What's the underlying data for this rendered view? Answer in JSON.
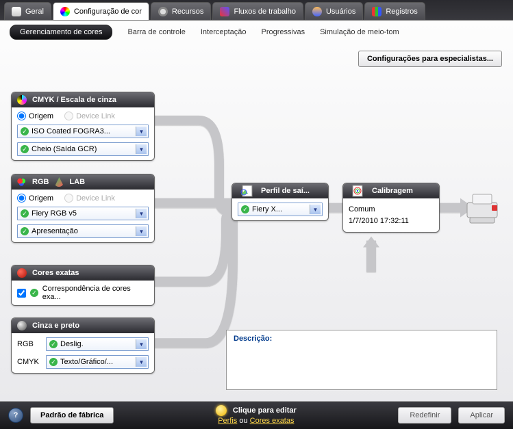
{
  "tabs": {
    "general": "Geral",
    "color": "Configuração de cor",
    "resources": "Recursos",
    "workflows": "Fluxos de trabalho",
    "users": "Usuários",
    "logs": "Registros"
  },
  "subtabs": {
    "mgmt": "Gerenciamento de cores",
    "controlbar": "Barra de controle",
    "trapping": "Interceptação",
    "progressives": "Progressivas",
    "halftone": "Simulação de meio-tom"
  },
  "expert_button": "Configurações para especialistas...",
  "panels": {
    "cmyk": {
      "title": "CMYK / Escala de cinza",
      "origin": "Origem",
      "devicelink": "Device Link",
      "select1": "ISO Coated FOGRA3...",
      "select2": "Cheio (Saída GCR)"
    },
    "rgb": {
      "title1": "RGB",
      "title2": "LAB",
      "origin": "Origem",
      "devicelink": "Device Link",
      "select1": "Fiery RGB v5",
      "select2": "Apresentação"
    },
    "spot": {
      "title": "Cores exatas",
      "check": "Correspondência de cores exa..."
    },
    "gray": {
      "title": "Cinza e preto",
      "rgb_label": "RGB",
      "cmyk_label": "CMYK",
      "select_rgb": "Deslig.",
      "select_cmyk": "Texto/Gráfico/..."
    },
    "output": {
      "title": "Perfil de saí...",
      "select": "Fiery X..."
    },
    "calib": {
      "title": "Calibragem",
      "name": "Comum",
      "date": "1/7/2010 17:32:11"
    }
  },
  "description_label": "Descrição:",
  "footer": {
    "factory": "Padrão de fábrica",
    "tip_line1": "Clique para editar",
    "tip_link1": "Perfis",
    "tip_or": " ou ",
    "tip_link2": "Cores exatas",
    "reset": "Redefinir",
    "apply": "Aplicar"
  }
}
